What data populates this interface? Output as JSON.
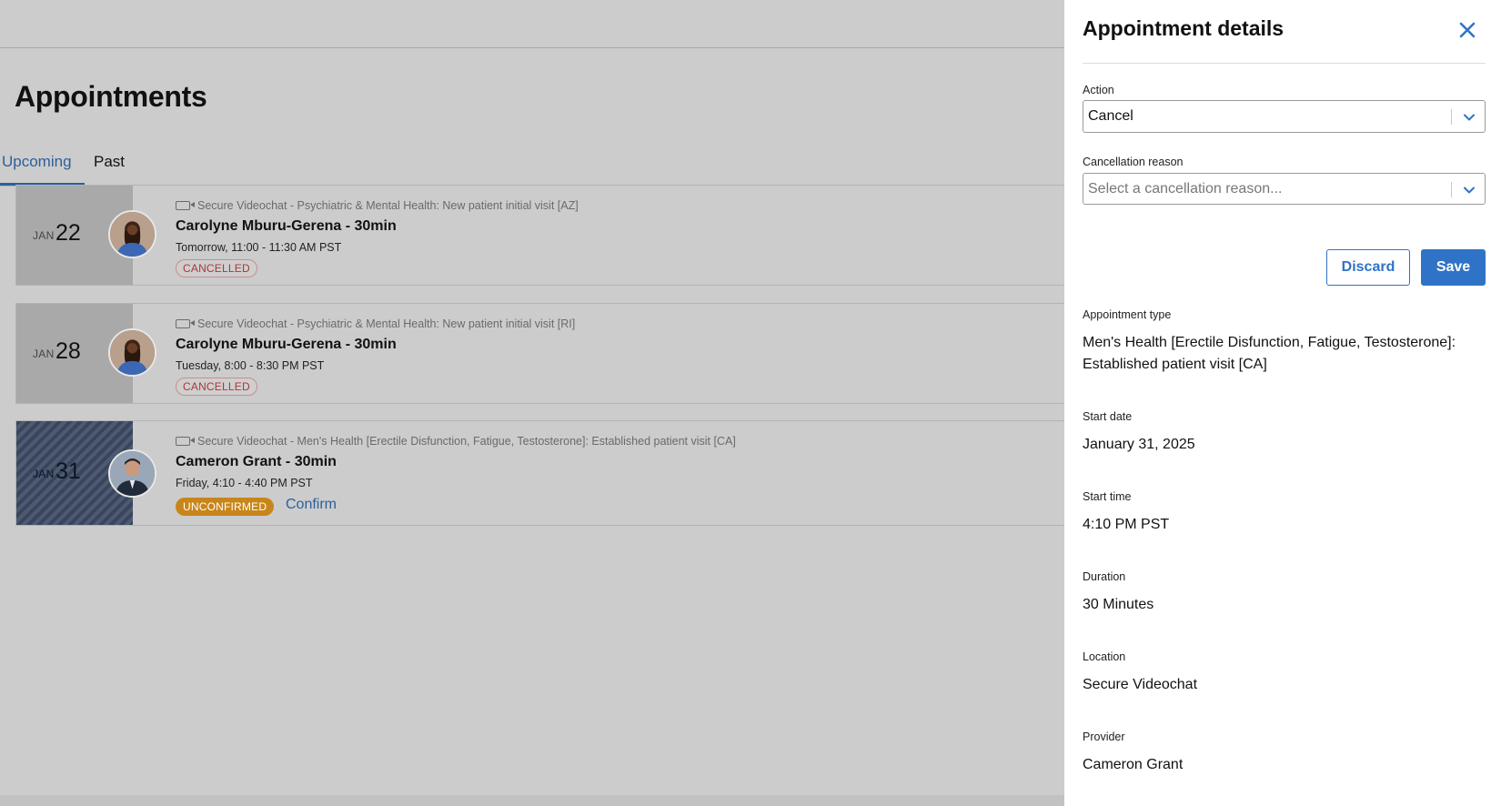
{
  "page": {
    "title": "Appointments",
    "tabs": [
      {
        "label": "Upcoming",
        "active": true
      },
      {
        "label": "Past",
        "active": false
      }
    ]
  },
  "appointments": [
    {
      "month": "JAN",
      "day": "22",
      "type": "Secure Videochat - Psychiatric & Mental Health: New patient initial visit [AZ]",
      "provider": "Carolyne Mburu-Gerena - 30min",
      "time": "Tomorrow, 11:00 - 11:30 AM PST",
      "status": "CANCELLED"
    },
    {
      "month": "JAN",
      "day": "28",
      "type": "Secure Videochat - Psychiatric & Mental Health: New patient initial visit [RI]",
      "provider": "Carolyne Mburu-Gerena - 30min",
      "time": "Tuesday, 8:00 - 8:30 PM PST",
      "status": "CANCELLED"
    },
    {
      "month": "JAN",
      "day": "31",
      "type": "Secure Videochat - Men's Health [Erectile Disfunction, Fatigue, Testosterone]: Established patient visit [CA]",
      "provider": "Cameron Grant - 30min",
      "time": "Friday, 4:10 - 4:40 PM PST",
      "status": "UNCONFIRMED",
      "action_label": "Confirm"
    }
  ],
  "panel": {
    "title": "Appointment details",
    "action": {
      "label": "Action",
      "value": "Cancel"
    },
    "cancellation_reason": {
      "label": "Cancellation reason",
      "placeholder": "Select a cancellation reason..."
    },
    "buttons": {
      "discard": "Discard",
      "save": "Save"
    },
    "details": {
      "appointment_type": {
        "label": "Appointment type",
        "value": "Men's Health [Erectile Disfunction, Fatigue, Testosterone]: Established patient visit [CA]"
      },
      "start_date": {
        "label": "Start date",
        "value": "January 31, 2025"
      },
      "start_time": {
        "label": "Start time",
        "value": "4:10 PM PST"
      },
      "duration": {
        "label": "Duration",
        "value": "30 Minutes"
      },
      "location": {
        "label": "Location",
        "value": "Secure Videochat"
      },
      "provider": {
        "label": "Provider",
        "value": "Cameron Grant"
      }
    }
  },
  "colors": {
    "accent": "#2f73c7",
    "tab_active": "#2c5f9c",
    "cancelled": "#b03535",
    "unconfirmed": "#c8861a",
    "overlay_bg": "#cccccc"
  },
  "icons": [
    "video-camera-icon",
    "close-icon",
    "chevron-down-icon"
  ]
}
